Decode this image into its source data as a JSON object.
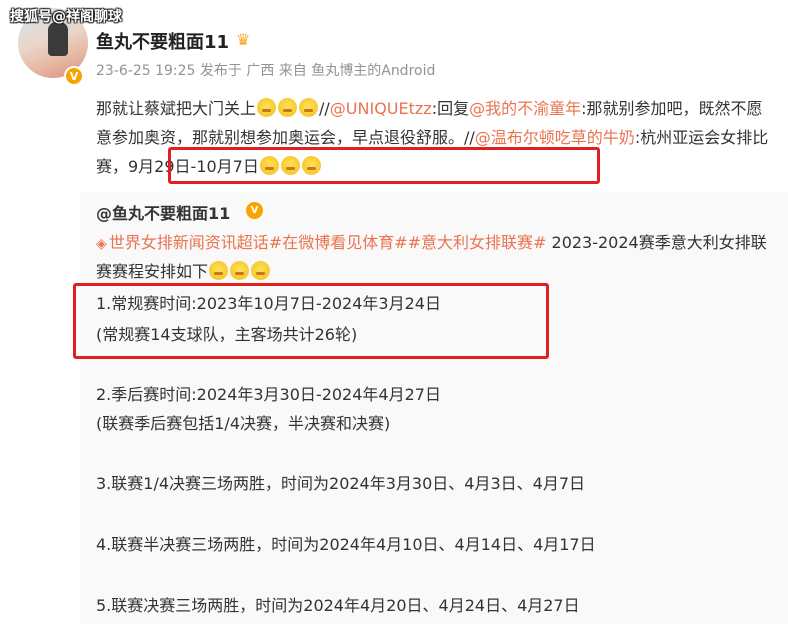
{
  "watermark": "搜狐号@祥阁聊球",
  "post": {
    "author": "鱼丸不要粗面11",
    "meta": "23-6-25 19:25 发布于 广西 来自 鱼丸博主的Android",
    "text_part1": "那就让蔡斌把大门关上",
    "sep1": "//",
    "mention1": "@UNIQUEtzz",
    "reply_text": ":回复",
    "mention2": "@我的不渝童年",
    "text_part2": ":那就别参加吧，既然不愿意参加奥资，那就别想参加奥运会，早点退役舒服。",
    "sep2": "//",
    "mention3": "@温布尔顿吃草的牛奶",
    "sep3": ":",
    "highlighted_text": "杭州亚运会女排比赛，9月29日-10月7日"
  },
  "repost": {
    "author": "@鱼丸不要粗面11",
    "topics": "世界女排新闻资讯超话#在微博看见体育##意大利女排联赛#",
    "intro": " 2023-2024赛季意大利女排联赛赛程安排如下",
    "lines": [
      "1.常规赛时间:2023年10月7日-2024年3月24日",
      "(常规赛14支球队，主客场共计26轮)",
      "2.季后赛时间:2024年3月30日-2024年4月27日",
      "(联赛季后赛包括1/4决赛，半决赛和决赛)",
      "3.联赛1/4决赛三场两胜，时间为2024年3月30日、4月3日、4月7日",
      "4.联赛半决赛三场两胜，时间为2024年4月10日、4月14日、4月17日",
      "5.联赛决赛三场两胜，时间为2024年4月20日、4月24日、4月27日"
    ]
  },
  "colors": {
    "link": "#eb7350",
    "highlight_border": "#e02020",
    "repost_bg": "#f9f9f9",
    "meta_text": "#939393"
  },
  "icons": {
    "crown": "crown-icon",
    "verified": "verified-badge-icon",
    "emoji": "smile-emoji-icon",
    "topic": "diamond-topic-icon"
  }
}
